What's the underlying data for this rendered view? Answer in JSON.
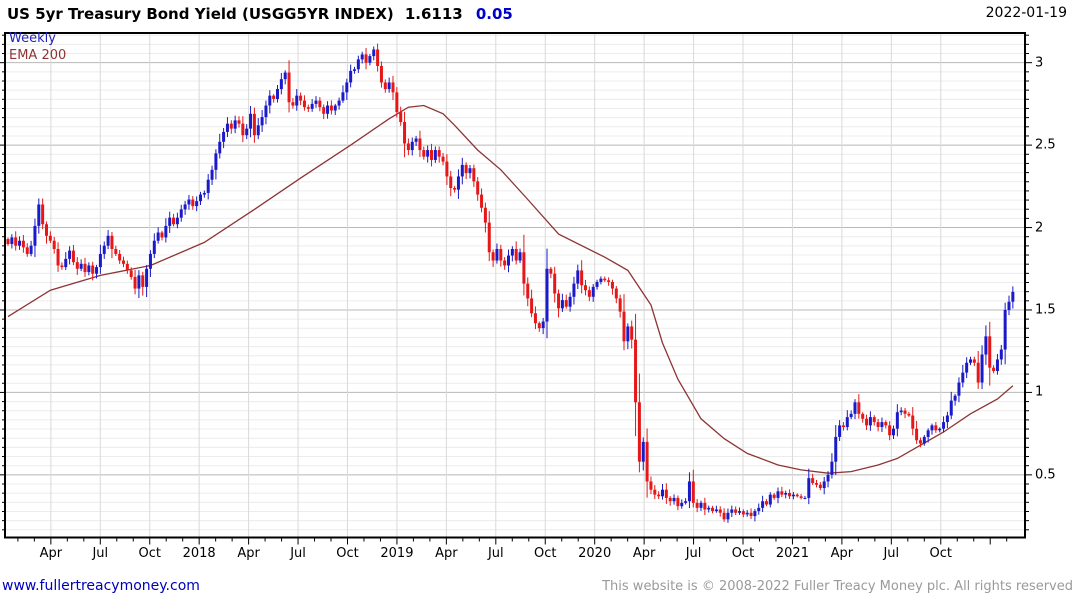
{
  "header": {
    "title": "US 5yr Treasury Bond Yield (USGG5YR INDEX)",
    "last_value": "1.6113",
    "change": "0.05",
    "date": "2022-01-19"
  },
  "legend": {
    "series_label": "Weekly",
    "overlay_label": "EMA 200"
  },
  "footer": {
    "site_url": "www.fullertreacymoney.com",
    "copyright": "This website is © 2008-2022 Fuller Treacy Money plc. All rights reserved"
  },
  "colors": {
    "up_candle": "#1a1ac8",
    "down_candle": "#e51717",
    "ema_line": "#8e3434",
    "change_text": "#0000cc",
    "weekly_label": "#2222bb",
    "link": "#0000bb",
    "copyright_text": "#9a9a9a",
    "major_grid": "#b8b8b8",
    "minor_grid": "#ececec",
    "vertical_grid": "#d9d9d9",
    "frame": "#000000"
  },
  "chart_data": {
    "type": "candlestick",
    "title": "US 5yr Treasury Bond Yield (USGG5YR INDEX)",
    "instrument": "USGG5YR INDEX",
    "interval": "weekly",
    "last": 1.6113,
    "change": 0.05,
    "start_week": "2017-01-13",
    "end_week": "2022-01-19",
    "grid": "major 0.5 horizontal, 9 minor subdivisions, vertical lines at quarters",
    "legend_position": "top-left inside plot",
    "y_axis": {
      "side": "right",
      "range": [
        0.12,
        3.18
      ],
      "major_ticks": [
        0.5,
        1.0,
        1.5,
        2.0,
        2.5,
        3.0
      ],
      "tick_labels": [
        "0.5",
        "1",
        "1.5",
        "2",
        "2.5",
        "3"
      ]
    },
    "x_axis": {
      "labels": [
        {
          "text": "Apr",
          "month": 3
        },
        {
          "text": "Jul",
          "month": 6
        },
        {
          "text": "Oct",
          "month": 9
        },
        {
          "text": "2018",
          "month": 12
        },
        {
          "text": "Apr",
          "month": 15
        },
        {
          "text": "Jul",
          "month": 18
        },
        {
          "text": "Oct",
          "month": 21
        },
        {
          "text": "2019",
          "month": 24
        },
        {
          "text": "Apr",
          "month": 27
        },
        {
          "text": "Jul",
          "month": 30
        },
        {
          "text": "Oct",
          "month": 33
        },
        {
          "text": "2020",
          "month": 36
        },
        {
          "text": "Apr",
          "month": 39
        },
        {
          "text": "Jul",
          "month": 42
        },
        {
          "text": "Oct",
          "month": 45
        },
        {
          "text": "2021",
          "month": 48
        },
        {
          "text": "Apr",
          "month": 51
        },
        {
          "text": "Jul",
          "month": 54
        },
        {
          "text": "Oct",
          "month": 57
        }
      ],
      "minor_tick_months": 61
    },
    "series": [
      {
        "name": "Weekly",
        "type": "candlestick",
        "weekly_closes": [
          1.9,
          1.94,
          1.89,
          1.92,
          1.88,
          1.84,
          1.89,
          2.01,
          2.14,
          2.02,
          1.95,
          1.92,
          1.87,
          1.77,
          1.76,
          1.81,
          1.86,
          1.79,
          1.75,
          1.78,
          1.73,
          1.77,
          1.72,
          1.76,
          1.84,
          1.89,
          1.95,
          1.87,
          1.84,
          1.8,
          1.78,
          1.74,
          1.7,
          1.63,
          1.71,
          1.64,
          1.75,
          1.84,
          1.92,
          1.97,
          1.94,
          2.01,
          2.06,
          2.02,
          2.06,
          2.11,
          2.14,
          2.17,
          2.13,
          2.16,
          2.2,
          2.21,
          2.29,
          2.35,
          2.45,
          2.52,
          2.58,
          2.63,
          2.6,
          2.65,
          2.63,
          2.56,
          2.6,
          2.69,
          2.56,
          2.62,
          2.67,
          2.74,
          2.8,
          2.78,
          2.84,
          2.9,
          2.94,
          2.76,
          2.74,
          2.8,
          2.77,
          2.73,
          2.72,
          2.75,
          2.77,
          2.73,
          2.69,
          2.74,
          2.71,
          2.74,
          2.77,
          2.82,
          2.88,
          2.95,
          2.96,
          3.02,
          3.05,
          3.0,
          3.04,
          3.08,
          2.98,
          2.88,
          2.84,
          2.88,
          2.82,
          2.7,
          2.64,
          2.51,
          2.47,
          2.52,
          2.54,
          2.47,
          2.43,
          2.47,
          2.41,
          2.47,
          2.43,
          2.4,
          2.31,
          2.24,
          2.23,
          2.31,
          2.38,
          2.33,
          2.36,
          2.28,
          2.2,
          2.12,
          2.03,
          1.85,
          1.8,
          1.87,
          1.8,
          1.77,
          1.83,
          1.87,
          1.8,
          1.85,
          1.66,
          1.57,
          1.48,
          1.42,
          1.39,
          1.43,
          1.75,
          1.72,
          1.6,
          1.51,
          1.56,
          1.52,
          1.58,
          1.66,
          1.74,
          1.65,
          1.62,
          1.58,
          1.64,
          1.67,
          1.69,
          1.68,
          1.67,
          1.63,
          1.57,
          1.49,
          1.31,
          1.4,
          1.32,
          0.94,
          0.58,
          0.7,
          0.46,
          0.41,
          0.38,
          0.37,
          0.41,
          0.36,
          0.34,
          0.36,
          0.31,
          0.33,
          0.34,
          0.46,
          0.33,
          0.3,
          0.33,
          0.29,
          0.3,
          0.28,
          0.29,
          0.27,
          0.23,
          0.27,
          0.29,
          0.27,
          0.28,
          0.26,
          0.27,
          0.25,
          0.28,
          0.3,
          0.34,
          0.32,
          0.38,
          0.36,
          0.4,
          0.38,
          0.39,
          0.37,
          0.38,
          0.37,
          0.36,
          0.36,
          0.48,
          0.45,
          0.44,
          0.42,
          0.46,
          0.5,
          0.58,
          0.73,
          0.8,
          0.79,
          0.85,
          0.87,
          0.94,
          0.87,
          0.84,
          0.8,
          0.85,
          0.82,
          0.79,
          0.82,
          0.8,
          0.74,
          0.78,
          0.88,
          0.89,
          0.87,
          0.86,
          0.78,
          0.71,
          0.69,
          0.73,
          0.77,
          0.8,
          0.77,
          0.78,
          0.82,
          0.86,
          0.95,
          0.98,
          1.06,
          1.12,
          1.18,
          1.2,
          1.18,
          1.06,
          1.23,
          1.34,
          1.15,
          1.13,
          1.2,
          1.26,
          1.5,
          1.55,
          1.61
        ]
      },
      {
        "name": "EMA 200",
        "type": "line",
        "keyframes": [
          [
            0,
            1.46
          ],
          [
            11,
            1.62
          ],
          [
            24,
            1.71
          ],
          [
            37,
            1.77
          ],
          [
            51,
            1.91
          ],
          [
            64,
            2.11
          ],
          [
            76,
            2.3
          ],
          [
            89,
            2.5
          ],
          [
            99,
            2.66
          ],
          [
            104,
            2.73
          ],
          [
            108,
            2.74
          ],
          [
            113,
            2.69
          ],
          [
            116,
            2.62
          ],
          [
            122,
            2.47
          ],
          [
            128,
            2.35
          ],
          [
            135,
            2.17
          ],
          [
            143,
            1.96
          ],
          [
            155,
            1.82
          ],
          [
            161,
            1.74
          ],
          [
            167,
            1.53
          ],
          [
            170,
            1.3
          ],
          [
            174,
            1.08
          ],
          [
            180,
            0.84
          ],
          [
            186,
            0.72
          ],
          [
            192,
            0.63
          ],
          [
            200,
            0.56
          ],
          [
            206,
            0.53
          ],
          [
            213,
            0.51
          ],
          [
            219,
            0.52
          ],
          [
            226,
            0.56
          ],
          [
            231,
            0.6
          ],
          [
            237,
            0.68
          ],
          [
            243,
            0.76
          ],
          [
            250,
            0.87
          ],
          [
            257,
            0.96
          ],
          [
            261,
            1.04
          ]
        ]
      }
    ]
  }
}
